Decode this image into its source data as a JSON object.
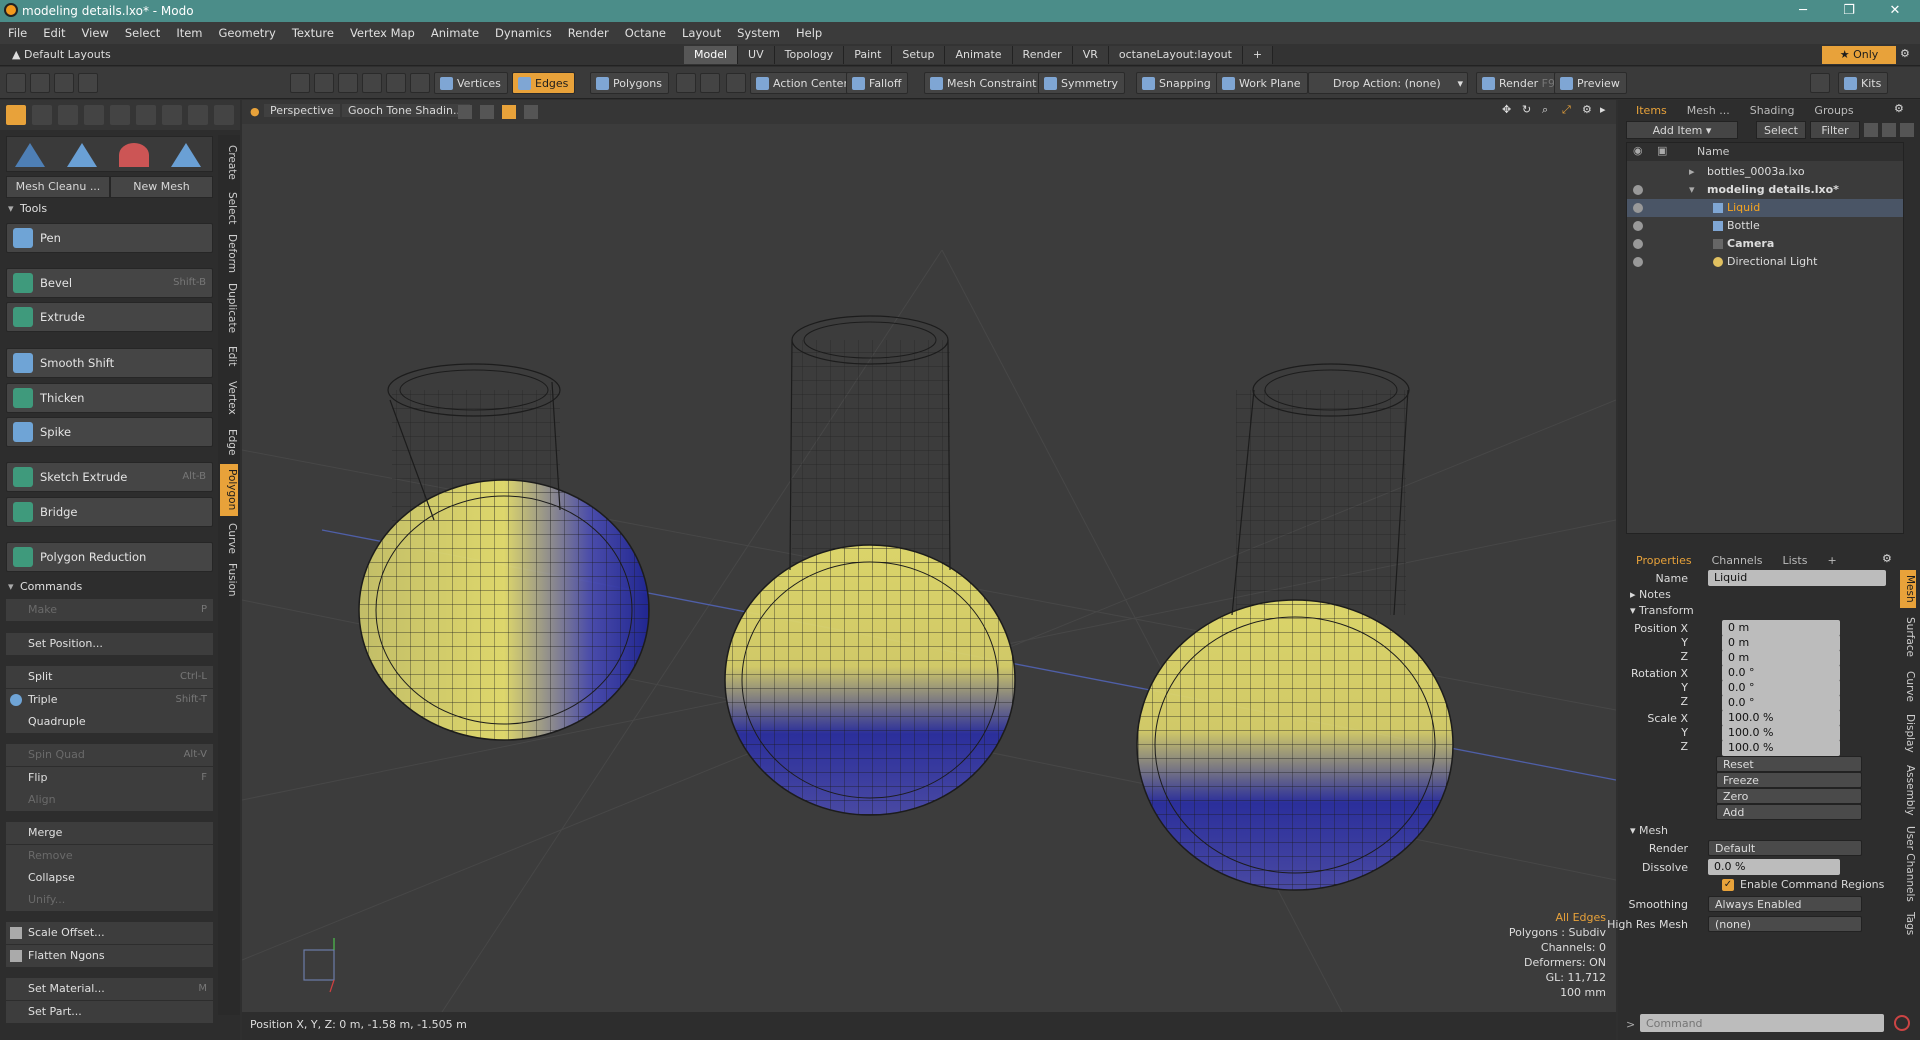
{
  "window": {
    "title": "modeling details.lxo* - Modo"
  },
  "menu": [
    "File",
    "Edit",
    "View",
    "Select",
    "Item",
    "Geometry",
    "Texture",
    "Vertex Map",
    "Animate",
    "Dynamics",
    "Render",
    "Octane",
    "Layout",
    "System",
    "Help"
  ],
  "layoutbar": {
    "default_layouts": "Default Layouts",
    "tabs": [
      "Model",
      "UV",
      "Topology",
      "Paint",
      "Setup",
      "Animate",
      "Render",
      "VR",
      "octaneLayout:layout"
    ],
    "active_tab": "Model",
    "only_label": "Only"
  },
  "toolbar": {
    "vertices": "Vertices",
    "edges": "Edges",
    "polygons": "Polygons",
    "action_center": "Action Center",
    "falloff": "Falloff",
    "mesh_constraint": "Mesh Constraint",
    "symmetry": "Symmetry",
    "snapping": "Snapping",
    "work_plane": "Work Plane",
    "drop_action": "Drop Action: (none)",
    "render": "Render",
    "render_key": "F9",
    "preview": "Preview",
    "kits": "Kits"
  },
  "left": {
    "mesh_cleanup": "Mesh Cleanu ...",
    "new_mesh": "New Mesh",
    "tools_header": "Tools",
    "tools": [
      {
        "label": "Pen",
        "shortcut": ""
      },
      {
        "label": "Bevel",
        "shortcut": "Shift-B"
      },
      {
        "label": "Extrude",
        "shortcut": ""
      },
      {
        "label": "Smooth Shift",
        "shortcut": ""
      },
      {
        "label": "Thicken",
        "shortcut": ""
      },
      {
        "label": "Spike",
        "shortcut": ""
      },
      {
        "label": "Sketch Extrude",
        "shortcut": "Alt-B"
      },
      {
        "label": "Bridge",
        "shortcut": ""
      },
      {
        "label": "Polygon Reduction",
        "shortcut": ""
      }
    ],
    "commands_header": "Commands",
    "commands": [
      {
        "label": "Make",
        "shortcut": "P",
        "disabled": true
      },
      {
        "label": "Set Position...",
        "shortcut": "",
        "disabled": false
      },
      {
        "label": "Split",
        "shortcut": "Ctrl-L",
        "disabled": false
      },
      {
        "label": "Triple",
        "shortcut": "Shift-T",
        "disabled": false
      },
      {
        "label": "Quadruple",
        "shortcut": "",
        "disabled": false
      },
      {
        "label": "Spin Quad",
        "shortcut": "Alt-V",
        "disabled": true
      },
      {
        "label": "Flip",
        "shortcut": "F",
        "disabled": false
      },
      {
        "label": "Align",
        "shortcut": "",
        "disabled": true
      },
      {
        "label": "Merge",
        "shortcut": "",
        "disabled": false
      },
      {
        "label": "Remove",
        "shortcut": "",
        "disabled": true
      },
      {
        "label": "Collapse",
        "shortcut": "",
        "disabled": false
      },
      {
        "label": "Unify...",
        "shortcut": "",
        "disabled": true
      },
      {
        "label": "Scale Offset...",
        "shortcut": "",
        "disabled": false
      },
      {
        "label": "Flatten Ngons",
        "shortcut": "",
        "disabled": false
      },
      {
        "label": "Set Material...",
        "shortcut": "M",
        "disabled": false
      },
      {
        "label": "Set Part...",
        "shortcut": "",
        "disabled": false
      }
    ],
    "vtabs": [
      "Create",
      "Select",
      "Deform",
      "Duplicate",
      "Edit",
      "Vertex",
      "Edge",
      "Polygon",
      "Curve",
      "Fusion"
    ],
    "active_vtab": "Polygon"
  },
  "viewport": {
    "view": "Perspective",
    "shading": "Gooch Tone Shadin...",
    "info": [
      "All Edges",
      "Polygons : Subdiv",
      "Channels: 0",
      "Deformers: ON",
      "GL: 11,712",
      "100 mm"
    ]
  },
  "status": {
    "text": "Position X, Y, Z:  0 m, -1.58 m, -1.505 m"
  },
  "right": {
    "tabs": [
      "Items",
      "Mesh ...",
      "Shading",
      "Groups"
    ],
    "add_item": "Add Item",
    "select": "Select",
    "filter": "Filter",
    "name_col": "Name",
    "items": [
      {
        "label": "bottles_0003a.lxo",
        "indent": 0,
        "bold": false,
        "selected": false
      },
      {
        "label": "modeling details.lxo*",
        "indent": 0,
        "bold": true,
        "selected": false
      },
      {
        "label": "Liquid",
        "indent": 2,
        "bold": false,
        "selected": true
      },
      {
        "label": "Bottle",
        "indent": 2,
        "bold": false,
        "selected": false
      },
      {
        "label": "Camera",
        "indent": 2,
        "bold": true,
        "selected": false
      },
      {
        "label": "Directional Light",
        "indent": 2,
        "bold": false,
        "selected": false
      }
    ],
    "prop_tabs": [
      "Properties",
      "Channels",
      "Lists"
    ],
    "name_label": "Name",
    "name_value": "Liquid",
    "notes": "Notes",
    "transform": "Transform",
    "position_label": "Position X",
    "rotation_label": "Rotation X",
    "scale_label": "Scale X",
    "y": "Y",
    "z": "Z",
    "position": [
      "0 m",
      "0 m",
      "0 m"
    ],
    "rotation": [
      "0.0 °",
      "0.0 °",
      "0.0 °"
    ],
    "scale": [
      "100.0 %",
      "100.0 %",
      "100.0 %"
    ],
    "actions": [
      "Reset",
      "Freeze",
      "Zero",
      "Add"
    ],
    "mesh": "Mesh",
    "render_label": "Render",
    "render_value": "Default",
    "dissolve_label": "Dissolve",
    "dissolve_value": "0.0 %",
    "enable_cmd": "Enable Command Regions",
    "smoothing_label": "Smoothing",
    "smoothing_value": "Always Enabled",
    "highres_label": "High Res Mesh",
    "highres_value": "(none)",
    "command_placeholder": "Command",
    "vtabs": [
      "Mesh",
      "Surface",
      "Curve",
      "Display",
      "Assembly",
      "User Channels",
      "Tags"
    ]
  }
}
